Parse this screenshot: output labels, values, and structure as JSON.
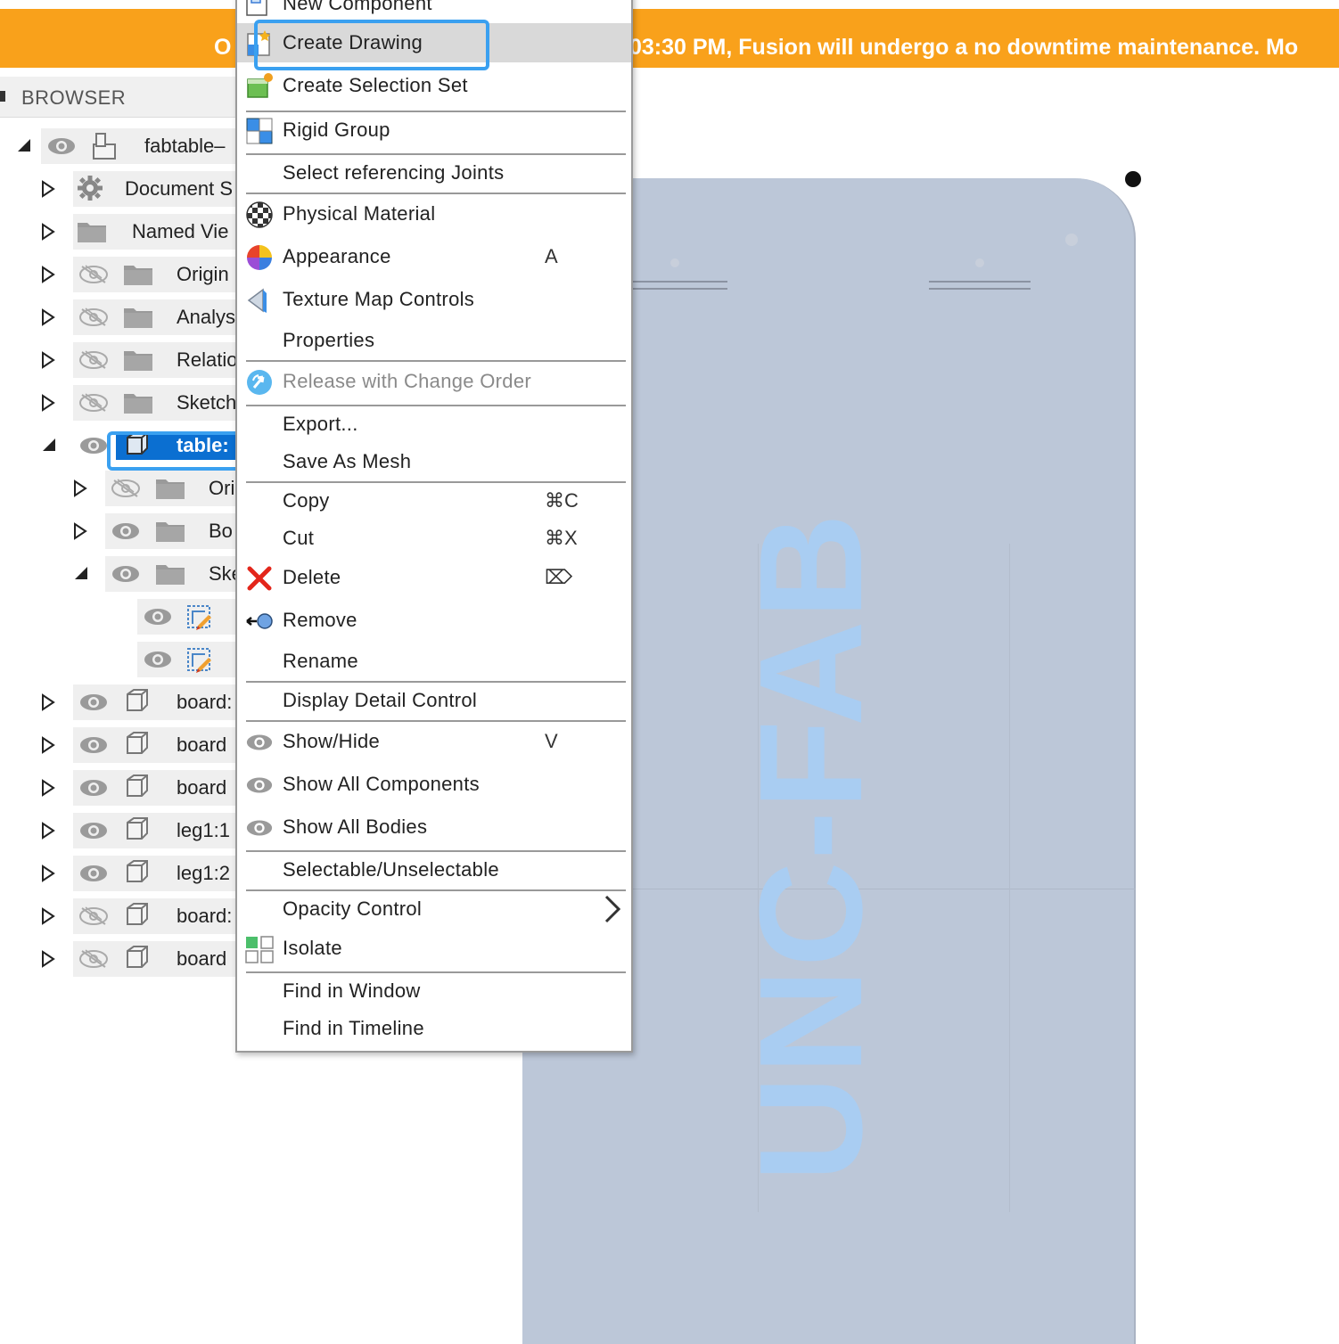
{
  "banner": {
    "left_text": "O",
    "text": "03:30 PM, Fusion will undergo a no downtime maintenance. Mo"
  },
  "browser": {
    "title": "BROWSER",
    "items": [
      {
        "label": "fabtable–",
        "icon": "component-icon",
        "visibility": "visible",
        "expanded": true
      },
      {
        "label": "Document S",
        "icon": "gear-icon",
        "expanded": false
      },
      {
        "label": "Named Vie",
        "icon": "folder-icon",
        "expanded": false
      },
      {
        "label": "Origin",
        "icon": "folder-icon",
        "visibility": "hidden",
        "expanded": false
      },
      {
        "label": "Analys",
        "icon": "folder-icon",
        "visibility": "hidden",
        "expanded": false
      },
      {
        "label": "Relatio",
        "icon": "folder-icon",
        "visibility": "hidden",
        "expanded": false
      },
      {
        "label": "Sketch",
        "icon": "folder-icon",
        "visibility": "hidden",
        "expanded": false
      },
      {
        "label": "table:",
        "icon": "body-icon",
        "visibility": "visible",
        "expanded": true,
        "selected": true
      },
      {
        "label": "Ori",
        "icon": "folder-icon",
        "visibility": "hidden",
        "expanded": false
      },
      {
        "label": "Bo",
        "icon": "folder-icon",
        "visibility": "visible",
        "expanded": false
      },
      {
        "label": "Ske",
        "icon": "folder-icon",
        "visibility": "visible",
        "expanded": true
      },
      {
        "label": "",
        "icon": "sketch-icon",
        "visibility": "visible"
      },
      {
        "label": "",
        "icon": "sketch-icon",
        "visibility": "visible"
      },
      {
        "label": "board:",
        "icon": "body-icon",
        "visibility": "visible",
        "expanded": false
      },
      {
        "label": "board",
        "icon": "body-icon",
        "visibility": "visible",
        "expanded": false
      },
      {
        "label": "board",
        "icon": "body-icon",
        "visibility": "visible",
        "expanded": false
      },
      {
        "label": "leg1:1",
        "icon": "body-icon",
        "visibility": "visible",
        "expanded": false
      },
      {
        "label": "leg1:2",
        "icon": "body-icon",
        "visibility": "visible",
        "expanded": false
      },
      {
        "label": "board:",
        "icon": "body-icon",
        "visibility": "hidden",
        "expanded": false
      },
      {
        "label": "board",
        "icon": "body-icon",
        "visibility": "hidden",
        "expanded": false
      }
    ]
  },
  "context_menu": {
    "items": [
      {
        "label": "New Component",
        "icon": "new-component-icon"
      },
      {
        "label": "Create Drawing",
        "icon": "create-drawing-icon",
        "highlighted": true
      },
      {
        "label": "Create Selection Set",
        "icon": "selection-set-icon"
      },
      {
        "label": "Rigid Group",
        "icon": "rigid-group-icon"
      },
      {
        "label": "Select referencing Joints"
      },
      {
        "label": "Physical Material",
        "icon": "physical-material-icon"
      },
      {
        "label": "Appearance",
        "icon": "appearance-icon",
        "shortcut": "A"
      },
      {
        "label": "Texture Map Controls",
        "icon": "texture-map-icon"
      },
      {
        "label": "Properties"
      },
      {
        "label": "Release with Change Order",
        "icon": "release-icon",
        "disabled": true
      },
      {
        "label": "Export..."
      },
      {
        "label": "Save As Mesh"
      },
      {
        "label": "Copy",
        "shortcut": "⌘C"
      },
      {
        "label": "Cut",
        "shortcut": "⌘X"
      },
      {
        "label": "Delete",
        "icon": "delete-icon",
        "shortcut": "⌦"
      },
      {
        "label": "Remove",
        "icon": "remove-icon"
      },
      {
        "label": "Rename"
      },
      {
        "label": "Display Detail Control"
      },
      {
        "label": "Show/Hide",
        "icon": "eye-icon",
        "shortcut": "V"
      },
      {
        "label": "Show All Components",
        "icon": "eye-icon"
      },
      {
        "label": "Show All Bodies",
        "icon": "eye-icon"
      },
      {
        "label": "Selectable/Unselectable"
      },
      {
        "label": "Opacity Control",
        "submenu": true
      },
      {
        "label": "Isolate",
        "icon": "isolate-icon"
      },
      {
        "label": "Find in Window"
      },
      {
        "label": "Find in Timeline"
      }
    ]
  },
  "canvas": {
    "logo_text": "UNC-FAB"
  },
  "colors": {
    "banner": "#f9a11b",
    "selection": "#0b6fd1",
    "highlight_outline": "#3aa0f0",
    "board": "#bcc7d8",
    "logo": "#a9cdf2"
  }
}
